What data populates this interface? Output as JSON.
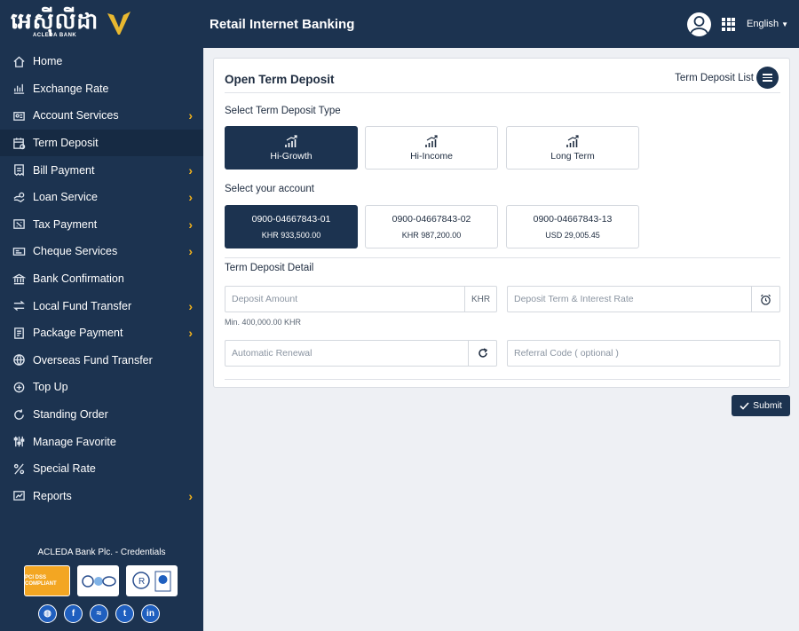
{
  "brand": {
    "logo_text": "អេស៊ីលីដា",
    "logo_sub": "ACLEDA BANK"
  },
  "header": {
    "title": "Retail Internet Banking",
    "language": "English",
    "avatar_icon": "user-avatar-icon",
    "apps_icon": "apps-grid-icon"
  },
  "sidebar": {
    "items": [
      {
        "label": "Home",
        "icon": "home-icon",
        "has_children": false,
        "active": false
      },
      {
        "label": "Exchange Rate",
        "icon": "bar-chart-icon",
        "has_children": false,
        "active": false
      },
      {
        "label": "Account Services",
        "icon": "account-icon",
        "has_children": true,
        "active": false
      },
      {
        "label": "Term Deposit",
        "icon": "deposit-icon",
        "has_children": false,
        "active": true
      },
      {
        "label": "Bill Payment",
        "icon": "bill-icon",
        "has_children": true,
        "active": false
      },
      {
        "label": "Loan Service",
        "icon": "loan-icon",
        "has_children": true,
        "active": false
      },
      {
        "label": "Tax Payment",
        "icon": "tax-icon",
        "has_children": true,
        "active": false
      },
      {
        "label": "Cheque Services",
        "icon": "cheque-icon",
        "has_children": true,
        "active": false
      },
      {
        "label": "Bank Confirmation",
        "icon": "bank-icon",
        "has_children": false,
        "active": false
      },
      {
        "label": "Local Fund Transfer",
        "icon": "transfer-icon",
        "has_children": true,
        "active": false
      },
      {
        "label": "Package Payment",
        "icon": "package-icon",
        "has_children": true,
        "active": false
      },
      {
        "label": "Overseas Fund Transfer",
        "icon": "globe-icon",
        "has_children": false,
        "active": false
      },
      {
        "label": "Top Up",
        "icon": "topup-icon",
        "has_children": false,
        "active": false
      },
      {
        "label": "Standing Order",
        "icon": "standing-order-icon",
        "has_children": false,
        "active": false
      },
      {
        "label": "Manage Favorite",
        "icon": "sliders-icon",
        "has_children": false,
        "active": false
      },
      {
        "label": "Special Rate",
        "icon": "special-rate-icon",
        "has_children": false,
        "active": false
      },
      {
        "label": "Reports",
        "icon": "reports-icon",
        "has_children": true,
        "active": false
      }
    ],
    "credentials_title": "ACLEDA Bank Plc. - Credentials",
    "badges": [
      {
        "label": "PCI DSS COMPLIANT"
      },
      {
        "label": "certification badge"
      },
      {
        "label": "registration badge"
      }
    ],
    "socials": [
      "website-icon",
      "facebook-icon",
      "messenger-icon",
      "twitter-icon",
      "linkedin-icon"
    ]
  },
  "page": {
    "title": "Open Term Deposit",
    "list_link": "Term Deposit List",
    "type_label": "Select Term Deposit Type",
    "types": [
      {
        "label": "Hi-Growth",
        "selected": true
      },
      {
        "label": "Hi-Income",
        "selected": false
      },
      {
        "label": "Long Term",
        "selected": false
      }
    ],
    "account_label": "Select your account",
    "accounts": [
      {
        "number": "0900-04667843-01",
        "balance": "KHR 933,500.00",
        "selected": true
      },
      {
        "number": "0900-04667843-02",
        "balance": "KHR 987,200.00",
        "selected": false
      },
      {
        "number": "0900-04667843-13",
        "balance": "USD 29,005.45",
        "selected": false
      }
    ],
    "detail_label": "Term Deposit Detail",
    "amount_placeholder": "Deposit Amount",
    "amount_currency": "KHR",
    "amount_hint": "Min. 400,000.00 KHR",
    "term_placeholder": "Deposit Term & Interest Rate",
    "renewal_placeholder": "Automatic Renewal",
    "referral_placeholder": "Referral Code ( optional )",
    "submit_label": "Submit"
  },
  "colors": {
    "navy": "#1c3350",
    "accent": "#f2b21c"
  }
}
